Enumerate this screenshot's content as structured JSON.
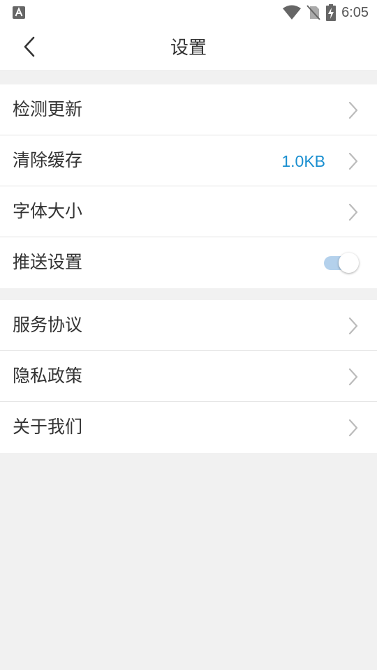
{
  "status_bar": {
    "time": "6:05",
    "app_icon": "a-letter-icon",
    "icons": [
      "wifi-icon",
      "no-sim-icon",
      "battery-charging-icon"
    ]
  },
  "header": {
    "title": "设置",
    "back_icon": "chevron-left-icon"
  },
  "group1": {
    "check_update_label": "检测更新",
    "clear_cache_label": "清除缓存",
    "cache_size": "1.0KB",
    "font_size_label": "字体大小",
    "push_settings_label": "推送设置",
    "push_enabled": true
  },
  "group2": {
    "service_agreement_label": "服务协议",
    "privacy_policy_label": "隐私政策",
    "about_us_label": "关于我们"
  },
  "colors": {
    "accent": "#1a8fd0",
    "toggle_track": "#b4d1ec",
    "background": "#f1f1f1"
  }
}
